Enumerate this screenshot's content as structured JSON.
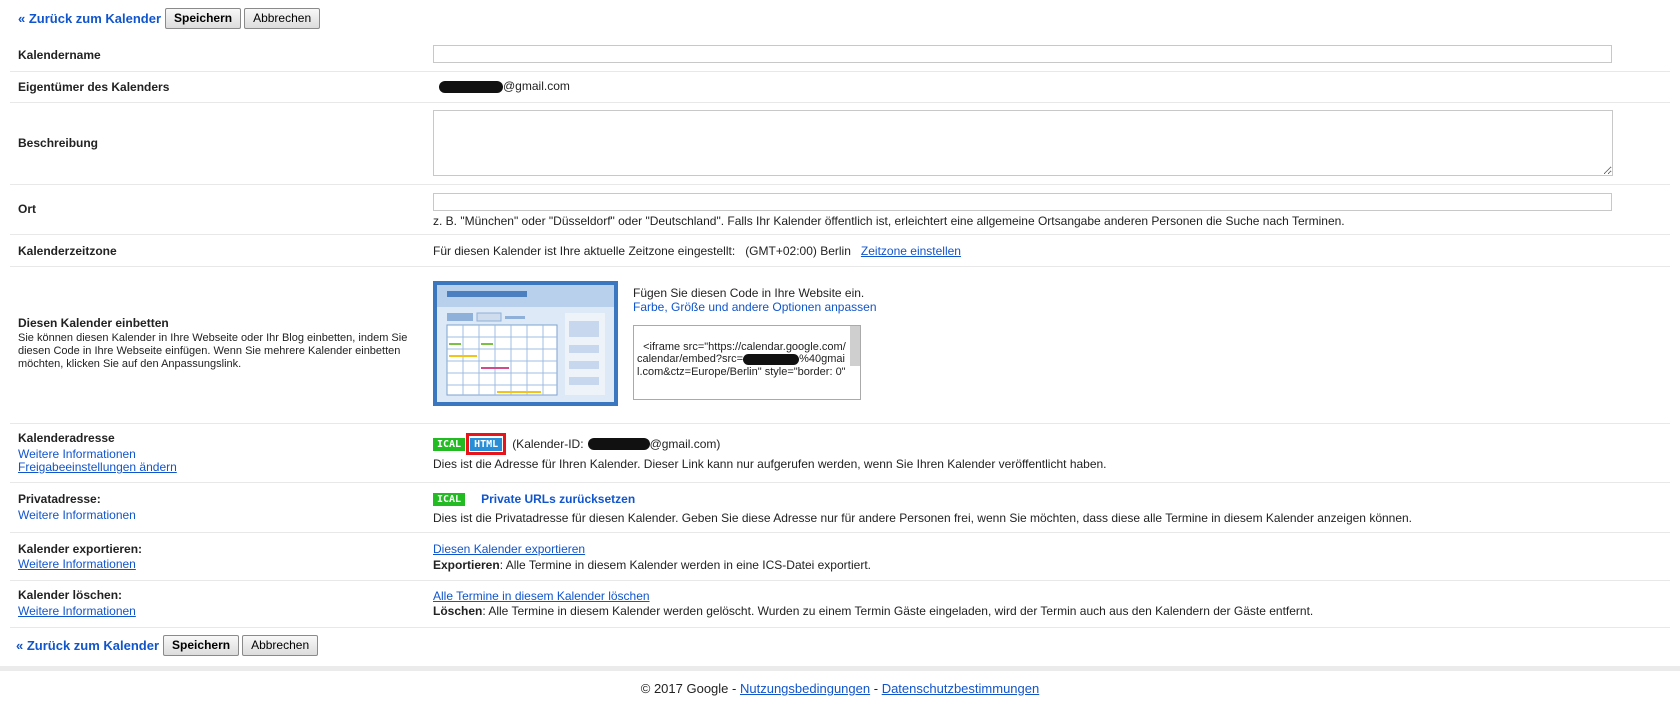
{
  "toolbar": {
    "back_label": "« Zurück zum Kalender",
    "save_label": "Speichern",
    "cancel_label": "Abbrechen"
  },
  "rows": {
    "name": {
      "label": "Kalendername",
      "value": ""
    },
    "owner": {
      "label": "Eigentümer des Kalenders",
      "value": "@gmail.com"
    },
    "description": {
      "label": "Beschreibung",
      "value": ""
    },
    "location": {
      "label": "Ort",
      "value": "",
      "hint": "z. B. \"München\" oder \"Düsseldorf\" oder \"Deutschland\". Falls Ihr Kalender öffentlich ist, erleichtert eine allgemeine Ortsangabe anderen Personen die Suche nach Terminen."
    },
    "timezone": {
      "label": "Kalenderzeitzone",
      "text": "Für diesen Kalender ist Ihre aktuelle Zeitzone eingestellt:",
      "zone": "(GMT+02:00) Berlin",
      "link": "Zeitzone einstellen"
    },
    "embed": {
      "label": "Diesen Kalender einbetten",
      "desc": "Sie können diesen Kalender in Ihre Webseite oder Ihr Blog einbetten, indem Sie diesen Code in Ihre Webseite einfügen. Wenn Sie mehrere Kalender einbetten möchten, klicken Sie auf den Anpassungslink.",
      "intro": "Fügen Sie diesen Code in Ihre Website ein.",
      "customize_link": "Farbe, Größe und andere Optionen anpassen",
      "code_part1": "<iframe src=\"https://calendar.google.com/calendar/embed?src=",
      "code_part2": "%40gmail.com&ctz=Europe/Berlin\" style=\"border: 0\""
    },
    "address": {
      "label": "Kalenderadresse",
      "link1": "Weitere Informationen",
      "link2": "Freigabeeinstellungen ändern",
      "ical": "ICAL",
      "html": "HTML",
      "id_prefix": "(Kalender-ID:",
      "id_suffix": "@gmail.com)",
      "note": "Dies ist die Adresse für Ihren Kalender. Dieser Link kann nur aufgerufen werden, wenn Sie Ihren Kalender veröffentlicht haben."
    },
    "private": {
      "label": "Privatadresse:",
      "link1": "Weitere Informationen",
      "ical": "ICAL",
      "reset": "Private URLs zurücksetzen",
      "note": "Dies ist die Privatadresse für diesen Kalender. Geben Sie diese Adresse nur für andere Personen frei, wenn Sie möchten, dass diese alle Termine in diesem Kalender anzeigen können."
    },
    "export": {
      "label": "Kalender exportieren:",
      "link1": "Weitere Informationen",
      "action": "Diesen Kalender exportieren",
      "note_bold": "Exportieren",
      "note": ": Alle Termine in diesem Kalender werden in eine ICS-Datei exportiert."
    },
    "delete": {
      "label": "Kalender löschen:",
      "link1": "Weitere Informationen",
      "action": "Alle Termine in diesem Kalender löschen",
      "note_bold": "Löschen",
      "note": ": Alle Termine in diesem Kalender werden gelöscht. Wurden zu einem Termin Gäste eingeladen, wird der Termin auch aus den Kalendern der Gäste entfernt."
    }
  },
  "footer": {
    "copyright": "© 2017 Google -",
    "terms": "Nutzungsbedingungen",
    "sep": "-",
    "privacy": "Datenschutzbestimmungen"
  }
}
